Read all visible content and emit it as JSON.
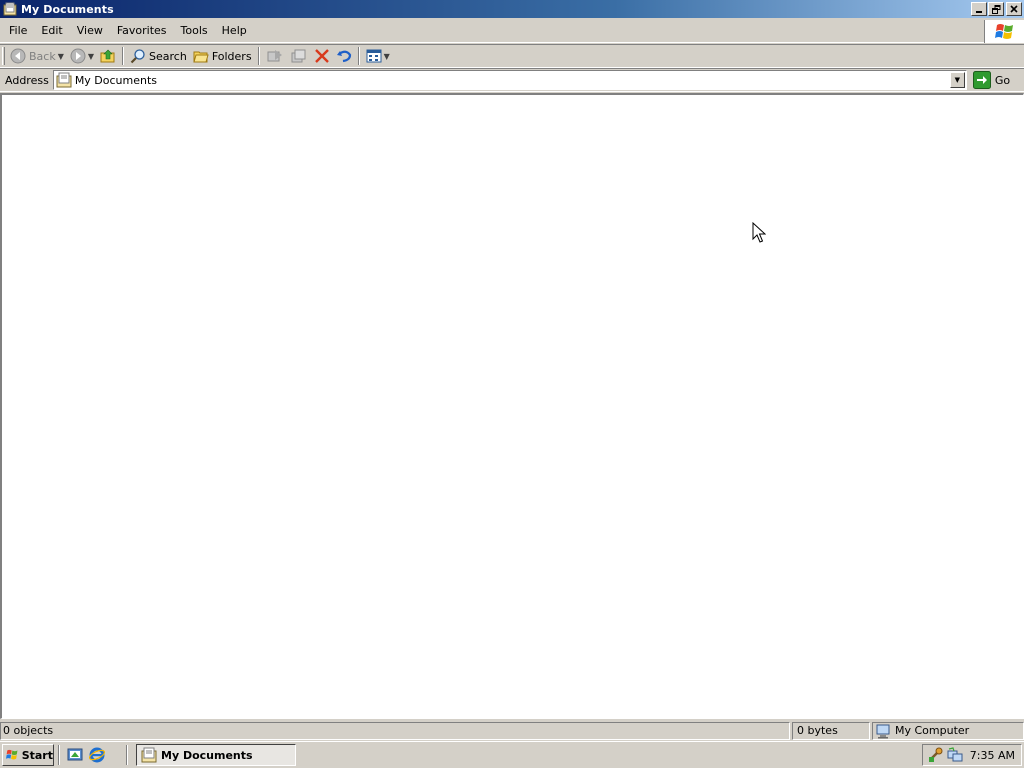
{
  "window": {
    "title": "My Documents",
    "icon": "folder-documents-icon",
    "controls": [
      "minimize",
      "restore",
      "close"
    ]
  },
  "menu": {
    "items": [
      "File",
      "Edit",
      "View",
      "Favorites",
      "Tools",
      "Help"
    ]
  },
  "toolbar": {
    "back_label": "Back",
    "search_label": "Search",
    "folders_label": "Folders"
  },
  "address": {
    "label": "Address",
    "value": "My Documents",
    "go_label": "Go"
  },
  "status": {
    "objects": "0 objects",
    "size": "0 bytes",
    "zone": "My Computer"
  },
  "taskbar": {
    "start_label": "Start",
    "task_label": "My Documents",
    "clock": "7:35 AM"
  },
  "colors": {
    "titlebar_start": "#0a246a",
    "titlebar_end": "#a6caf0",
    "chrome": "#d4d0c8"
  }
}
